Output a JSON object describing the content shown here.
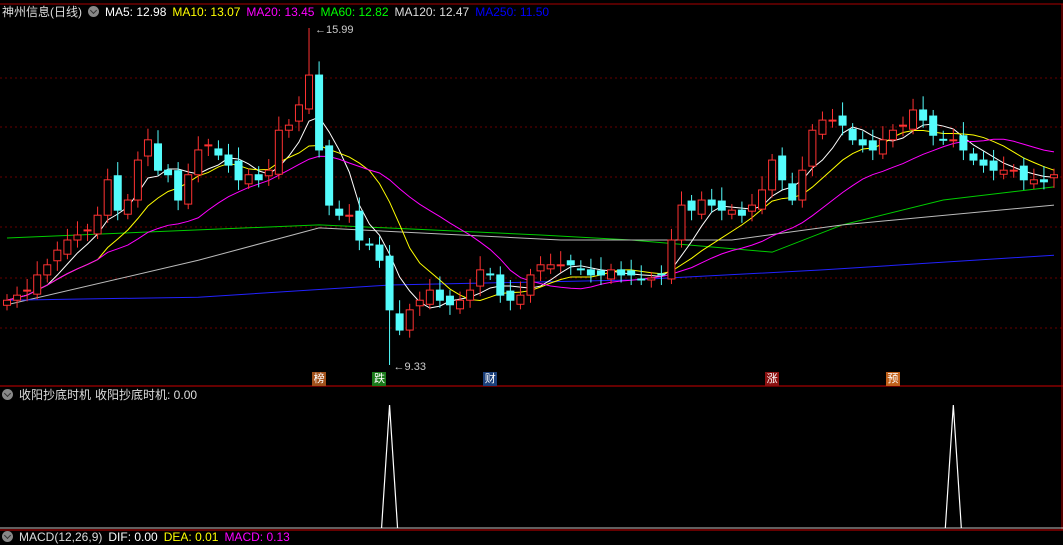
{
  "header": {
    "title": "神州信息(日线)",
    "ma": [
      {
        "label": "MA5: 12.98",
        "color": "#ffffff"
      },
      {
        "label": "MA10: 13.07",
        "color": "#ffff00"
      },
      {
        "label": "MA20: 13.45",
        "color": "#ff00ff"
      },
      {
        "label": "MA60: 12.82",
        "color": "#00ff00"
      },
      {
        "label": "MA120: 12.47",
        "color": "#dddddd"
      },
      {
        "label": "MA250: 11.50",
        "color": "#0000ff"
      }
    ]
  },
  "indicator": {
    "name": "收阳抄底时机",
    "value_label": "收阳抄底时机: 0.00",
    "signals": [
      38,
      94
    ]
  },
  "macd": {
    "label": "MACD(12,26,9)",
    "dif": "DIF: 0.00",
    "dea": "DEA: 0.01",
    "macd": "MACD: 0.13"
  },
  "annotations": {
    "high": "15.99",
    "low": "9.33",
    "high_index": 30,
    "low_index": 38
  },
  "markers": [
    {
      "text": "榜",
      "index": 31,
      "color": "#a0501a"
    },
    {
      "text": "跌",
      "index": 37,
      "color": "#1a7a1a"
    },
    {
      "text": "财",
      "index": 48,
      "color": "#1a3f7a"
    },
    {
      "text": "涨",
      "index": 76,
      "color": "#8a1010"
    },
    {
      "text": "预",
      "index": 88,
      "color": "#c0601a"
    }
  ],
  "chart_data": {
    "type": "candlestick",
    "ylim": [
      9.1,
      16.5
    ],
    "closes": [
      10.61,
      10.71,
      10.81,
      11.11,
      11.31,
      11.6,
      11.8,
      11.9,
      12.0,
      12.29,
      12.99,
      12.39,
      12.59,
      13.38,
      13.78,
      13.18,
      13.09,
      12.59,
      13.09,
      13.58,
      13.68,
      13.48,
      13.28,
      12.99,
      13.09,
      12.99,
      13.18,
      13.97,
      14.07,
      14.47,
      15.06,
      13.58,
      12.49,
      12.29,
      12.29,
      11.8,
      11.7,
      11.4,
      10.42,
      10.02,
      10.42,
      10.61,
      10.81,
      10.61,
      10.52,
      10.61,
      10.81,
      11.21,
      11.11,
      10.71,
      10.61,
      10.71,
      11.11,
      11.31,
      11.31,
      11.31,
      11.31,
      11.21,
      11.11,
      11.11,
      11.21,
      11.11,
      11.11,
      11.01,
      11.05,
      11.11,
      11.8,
      12.49,
      12.39,
      12.59,
      12.49,
      12.39,
      12.39,
      12.29,
      12.49,
      12.79,
      13.38,
      12.99,
      12.59,
      13.18,
      13.97,
      14.17,
      14.17,
      14.07,
      13.78,
      13.68,
      13.58,
      13.78,
      13.97,
      14.07,
      14.37,
      14.17,
      13.87,
      13.78,
      13.78,
      13.58,
      13.38,
      13.28,
      13.18,
      13.18,
      13.18,
      12.99,
      12.99,
      12.95,
      13.09
    ],
    "ma_long": [
      {
        "name": "MA60",
        "color": "#00cc00",
        "points": [
          [
            0,
            11.84
          ],
          [
            31,
            12.1
          ],
          [
            53,
            11.9
          ],
          [
            62,
            11.8
          ],
          [
            76,
            11.56
          ],
          [
            83,
            12.1
          ],
          [
            93,
            12.59
          ],
          [
            104,
            12.85
          ]
        ]
      },
      {
        "name": "MA120",
        "color": "#bbbbbb",
        "points": [
          [
            0,
            10.52
          ],
          [
            19,
            11.4
          ],
          [
            31,
            12.04
          ],
          [
            55,
            11.8
          ],
          [
            72,
            11.8
          ],
          [
            83,
            12.1
          ],
          [
            104,
            12.49
          ]
        ]
      },
      {
        "name": "MA250",
        "color": "#2222ff",
        "points": [
          [
            0,
            10.61
          ],
          [
            19,
            10.67
          ],
          [
            38,
            10.91
          ],
          [
            62,
            11.01
          ],
          [
            81,
            11.21
          ],
          [
            104,
            11.5
          ]
        ]
      }
    ]
  }
}
